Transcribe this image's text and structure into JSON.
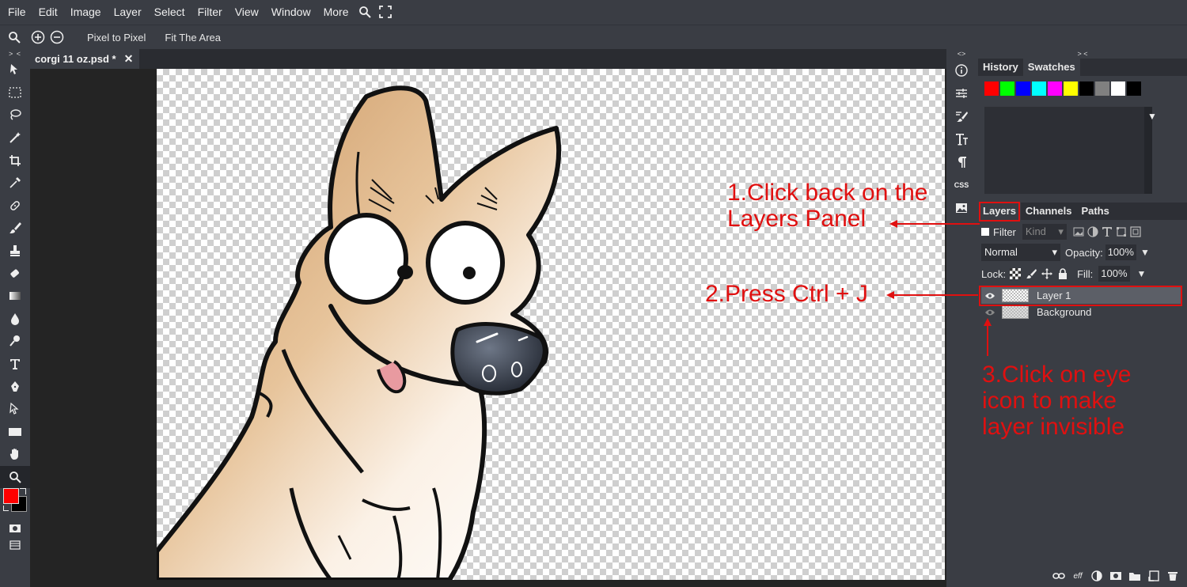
{
  "menu": {
    "items": [
      "File",
      "Edit",
      "Image",
      "Layer",
      "Select",
      "Filter",
      "View",
      "Window",
      "More"
    ]
  },
  "options": {
    "pixel_to_pixel": "Pixel to Pixel",
    "fit_area": "Fit The Area"
  },
  "collapse_glyphs": {
    "left": "> <",
    "mini": "<>",
    "right": "> <"
  },
  "document": {
    "tab_title": "corgi 11 oz.psd *",
    "close_glyph": "✕"
  },
  "colors": {
    "foreground": "#ff0000",
    "background": "#000000",
    "annotation": "#e01010",
    "panel": "#3a3d44",
    "panel_dark": "#2d2f35"
  },
  "annotations": {
    "step1": "1.Click back on the\nLayers Panel",
    "step2": "2.Press Ctrl + J",
    "step3": "3.Click on eye\nicon to make\nlayer invisible"
  },
  "mini_icons": [
    "info-icon",
    "adjustments-icon",
    "brush-settings-icon",
    "character-icon",
    "paragraph-icon",
    "css-icon",
    "image-icon"
  ],
  "mini_css_label": "CSS",
  "history_panel": {
    "tabs": [
      "History",
      "Swatches"
    ],
    "active_tab": "Swatches",
    "swatch_colors": [
      "#ff0000",
      "#00ff00",
      "#0000ff",
      "#00ffff",
      "#ff00ff",
      "#ffff00",
      "#000000",
      "#808080",
      "#ffffff",
      "#000000"
    ],
    "menu_glyph": "▼"
  },
  "layers_panel": {
    "tabs": [
      "Layers",
      "Channels",
      "Paths"
    ],
    "active_tab": "Layers",
    "filter_label": "Filter",
    "kind_placeholder": "Kind",
    "blend_mode": "Normal",
    "opacity_label": "Opacity:",
    "opacity_value": "100%",
    "lock_label": "Lock:",
    "fill_label": "Fill:",
    "fill_value": "100%",
    "dropdown_glyph": "▼",
    "layers": [
      {
        "name": "Layer 1",
        "visible": true,
        "selected": true
      },
      {
        "name": "Background",
        "visible": true,
        "selected": false
      }
    ],
    "footer_eff": "eff"
  }
}
